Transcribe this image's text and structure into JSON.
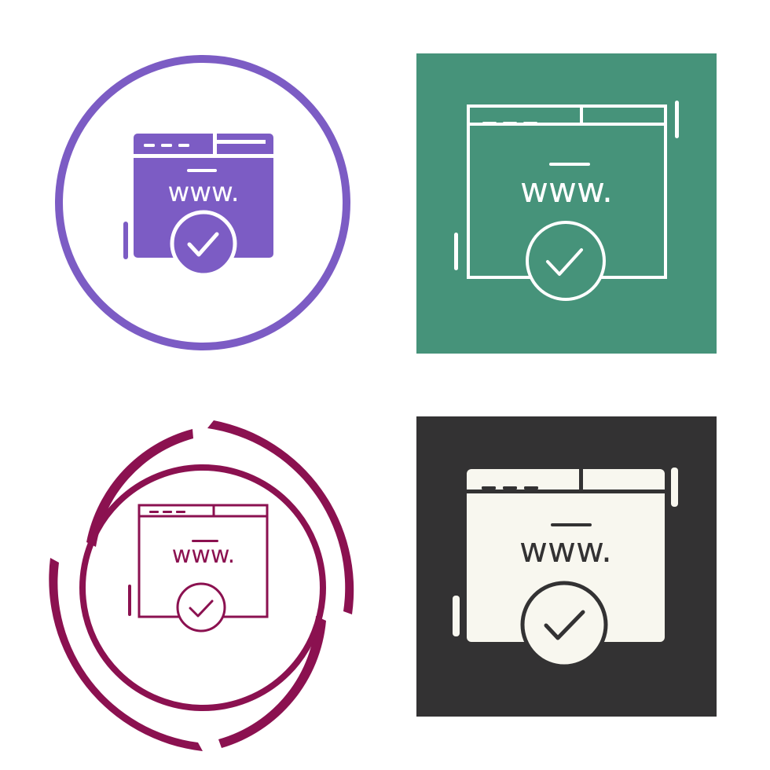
{
  "icons": [
    {
      "text": "www.",
      "style": "purple glyph in circle outline",
      "color": "#7c5cc4"
    },
    {
      "text": "www.",
      "style": "white line on green square",
      "color": "#46937a"
    },
    {
      "text": "www.",
      "style": "crimson line in split circle",
      "color": "#8b1150"
    },
    {
      "text": "www.",
      "style": "cream glyph on dark square",
      "color": "#333233"
    }
  ],
  "colors": {
    "purple": "#7c5cc4",
    "green": "#46937a",
    "crimson": "#8b1150",
    "dark": "#333233",
    "cream": "#f8f7ef",
    "white": "#ffffff"
  }
}
